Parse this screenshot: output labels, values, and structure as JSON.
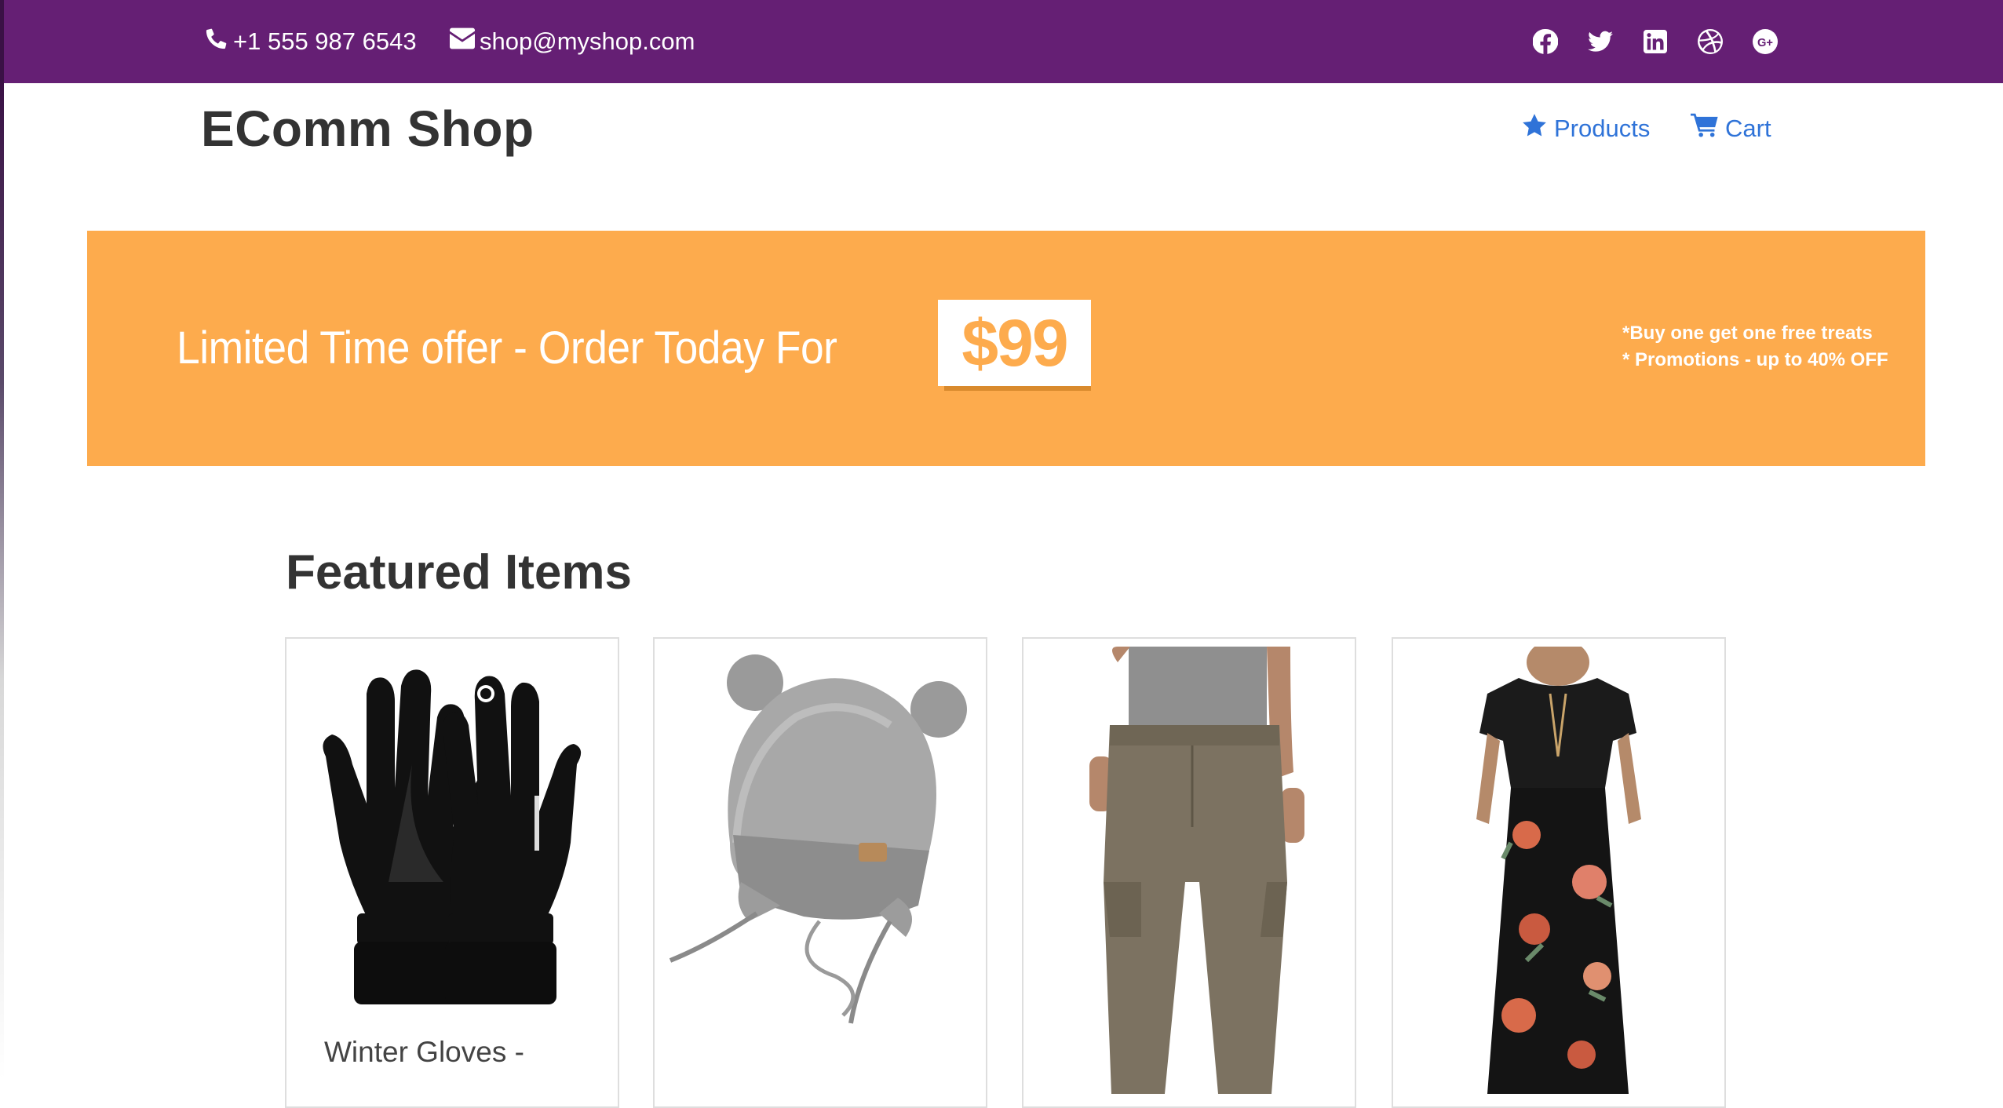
{
  "topbar": {
    "phone": "+1 555 987 6543",
    "email": "shop@myshop.com",
    "phone_icon": "phone-icon",
    "email_icon": "envelope-icon",
    "socials": [
      "facebook-icon",
      "twitter-icon",
      "linkedin-icon",
      "dribbble-icon",
      "google-plus-icon"
    ],
    "background_color": "#651f74"
  },
  "header": {
    "brand": "EComm Shop",
    "nav": [
      {
        "label": "Products",
        "icon": "star-icon"
      },
      {
        "label": "Cart",
        "icon": "shopping-cart-icon"
      }
    ],
    "link_color": "#2f73d8"
  },
  "banner": {
    "headline": "Limited Time offer - Order Today For",
    "price": "$99",
    "notes": [
      "*Buy one get one free treats",
      "* Promotions - up to 40% OFF"
    ],
    "background_color": "#fdab4d"
  },
  "featured": {
    "title": "Featured Items",
    "items": [
      {
        "title": "Winter Gloves -",
        "image": "black winter gloves"
      },
      {
        "title": "",
        "image": "grey knit baby hat"
      },
      {
        "title": "",
        "image": "khaki cargo pants"
      },
      {
        "title": "",
        "image": "black floral maxi dress"
      }
    ]
  }
}
